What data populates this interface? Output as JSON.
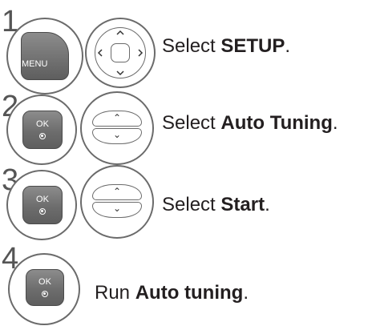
{
  "steps": [
    {
      "number": "1",
      "button_label": "MENU",
      "button_icon": "menu-button-icon",
      "nav_icon": "four-way-navigation-icon",
      "text_prefix": "Select ",
      "text_bold": "SETUP",
      "text_suffix": "."
    },
    {
      "number": "2",
      "button_label": "OK",
      "button_icon": "ok-button-icon",
      "nav_icon": "up-down-navigation-icon",
      "text_prefix": "Select ",
      "text_bold": "Auto Tuning",
      "text_suffix": "."
    },
    {
      "number": "3",
      "button_label": "OK",
      "button_icon": "ok-button-icon",
      "nav_icon": "up-down-navigation-icon",
      "text_prefix": "Select ",
      "text_bold": "Start",
      "text_suffix": "."
    },
    {
      "number": "4",
      "button_label": "OK",
      "button_icon": "ok-button-icon",
      "text_prefix": "Run ",
      "text_bold": "Auto tuning",
      "text_suffix": "."
    }
  ],
  "colors": {
    "button_fill": "#6d6d6d",
    "outline": "#6b6b6b",
    "text": "#231f20"
  }
}
